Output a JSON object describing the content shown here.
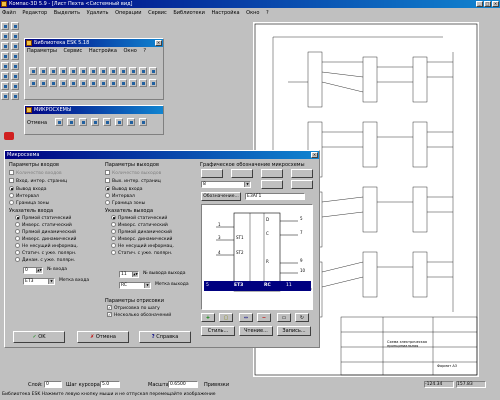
{
  "app": {
    "title": "Компас-3D 5.9 - [Лист Пехта <Системный вид]",
    "menu": [
      "Файл",
      "Редактор",
      "Выделить",
      "Удалить",
      "Операции",
      "Сервис",
      "Библиотеки",
      "Настройка",
      "Окно",
      "?"
    ]
  },
  "library_window": {
    "title": "Библиотека ESK 5.18",
    "menu": [
      "Параметры",
      "Сервис",
      "Настройка",
      "Окно",
      "?"
    ]
  },
  "microscheme_panel": {
    "title": "МИКРОСХЕМЫ",
    "label": "Отмена"
  },
  "dialog": {
    "title": "Микросхема",
    "inputs_group": {
      "title": "Параметры входов",
      "field1": "Количество входов",
      "field2": "Вход. интер. страниц",
      "radio1": "Вывод входа",
      "radio2": "Интервал",
      "radio3": "Граница зоны",
      "indicator_title": "Указатель входа",
      "indicators": [
        "Прямой статический",
        "Инверс. статический",
        "Прямой динамический",
        "Инверс. динамический",
        "Не несущий информац.",
        "Статич. с уже. полярн.",
        "Динам. с уже. полярн."
      ],
      "count_value": "0",
      "count_label": "№ входа",
      "type_value": "ЕТ3",
      "type_label": "Метка входа"
    },
    "outputs_group": {
      "title": "Параметры выходов",
      "field1": "Количество выходов",
      "field2": "Вых. интер. страниц",
      "radio1": "Вывод входа",
      "radio2": "Интервал",
      "radio3": "Граница зоны",
      "indicator_title": "Указатель выхода",
      "indicators": [
        "Прямой статический",
        "Инверс. статический",
        "Прямой динамический",
        "Инверс. динамический",
        "Не несущий информац.",
        "Статич. с уже. полярн."
      ],
      "count_value": "11",
      "count_label": "№ вывода выхода",
      "type_value": "RC",
      "type_label": "Метка выхода"
    },
    "render_group": {
      "title": "Параметры отрисовки",
      "check1": "Отрисовка по шагу",
      "check2": "Несколько обозначений"
    },
    "graphic": {
      "title": "Графическое обозначение микросхемы",
      "combo_value": "8",
      "designation_label": "Обозначение...",
      "designation_value": "ЕЗАГ1",
      "pins_left": [
        "1",
        "3",
        "4",
        "5"
      ],
      "pins_right": [
        "5",
        "7",
        "9",
        "10",
        "11"
      ],
      "labels_left": [
        "ST1",
        "ST2"
      ],
      "labels_mid": [
        "D",
        "C",
        "R"
      ],
      "labels_right": [
        "Q",
        "Q"
      ],
      "selected_row": {
        "left_pin": "5",
        "left_label": "ET3",
        "right_label": "RC",
        "right_pin": "11"
      },
      "btn_style": "Стиль...",
      "btn_text": "Чтение...",
      "btn_save": "Запись..."
    },
    "buttons": {
      "ok": "OK",
      "cancel": "Отмена",
      "help": "Справка"
    }
  },
  "drawing": {
    "title_block_text": "Формат А3",
    "company": "Схема электрическая принципиальная"
  },
  "status_bar": {
    "scale_label": "Слой:",
    "scale_value": "0",
    "step_label": "Шаг курсора",
    "step_value": "5.0",
    "zoom_label": "Масштаб",
    "zoom_value": "0.6500",
    "snap_label": "Привязки",
    "coord_x": "-124.34",
    "coord_y": "157.83",
    "hint": "Библиотека ESK  Нажмите левую кнопку мыши и не отпуская перемещайте изображение"
  }
}
